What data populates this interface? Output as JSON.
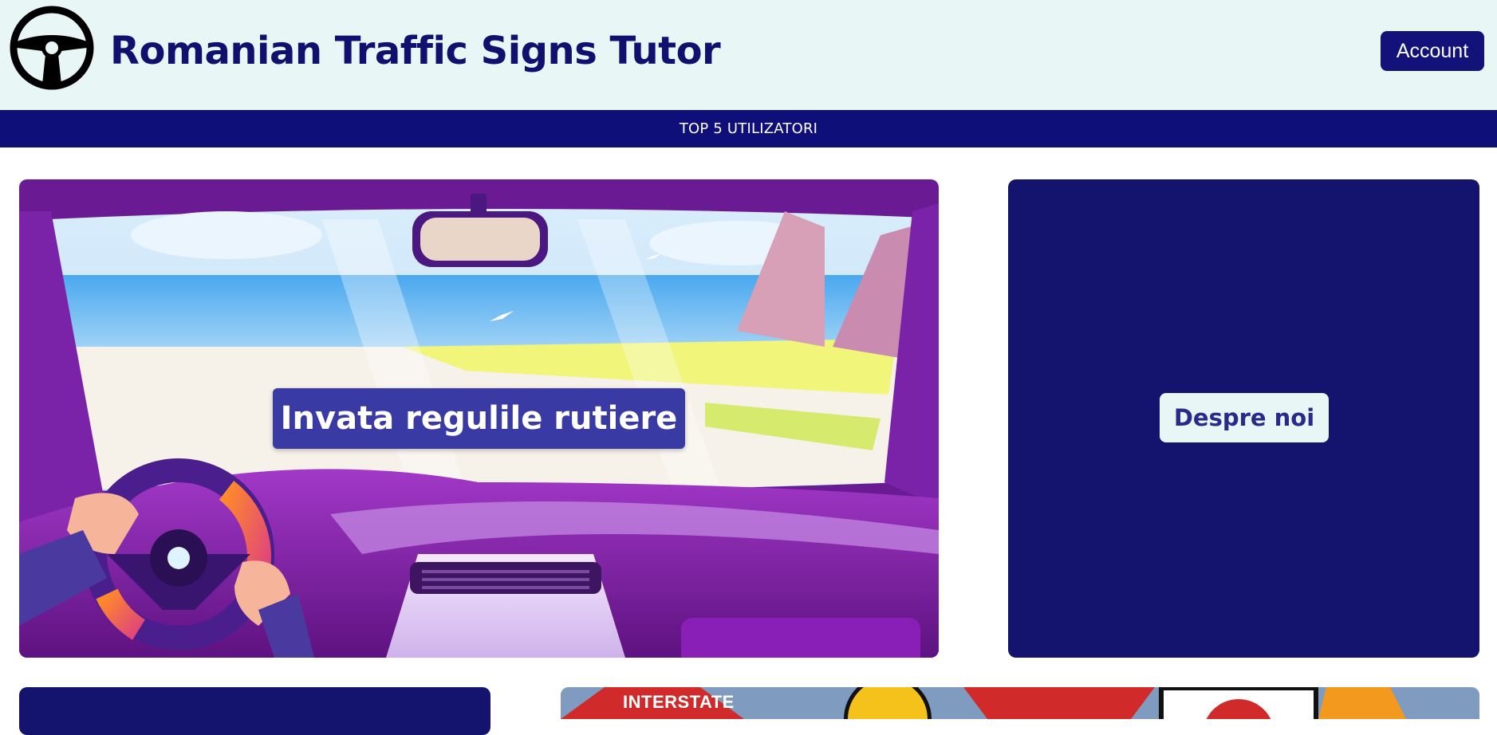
{
  "header": {
    "title": "Romanian Traffic Signs Tutor",
    "logo_icon": "steering-wheel-icon",
    "account_label": "Account"
  },
  "nav": {
    "items": [
      {
        "label": "TOP 5 UTILIZATORI"
      }
    ]
  },
  "hero": {
    "button_label": "Invata regulile rutiere",
    "image": "car-interior-beach-illustration"
  },
  "about": {
    "button_label": "Despre noi"
  },
  "bottom": {
    "sign_text": "INTERSTATE"
  },
  "colors": {
    "header_bg": "#e9f6f6",
    "brand_navy": "#10106e",
    "nav_bg": "#0f0f7a",
    "hero_button_bg": "#3a3aa5"
  }
}
